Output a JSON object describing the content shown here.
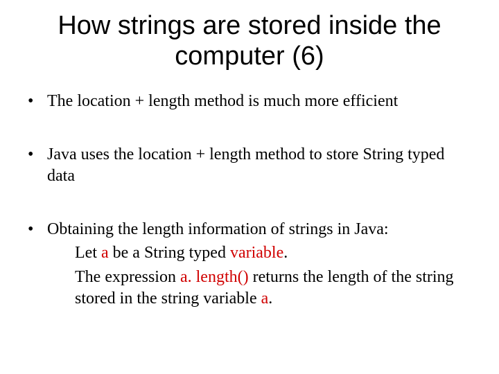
{
  "title": "How strings are stored inside the computer (6)",
  "bullets": {
    "b1": " The location + length method is much more efficient",
    "b2": "Java uses the location + length method to store String typed data",
    "b3": "Obtaining the length information of strings in Java:"
  },
  "sub": {
    "s1a": "Let ",
    "s1_red1": "a",
    "s1b": " be a String typed ",
    "s1_red2": "variable",
    "s1c": ".",
    "s2a": "The expression ",
    "s2_red1": "a. length()",
    "s2b": " returns the length of the string stored in the string variable ",
    "s2_red2": "a",
    "s2c": "."
  }
}
